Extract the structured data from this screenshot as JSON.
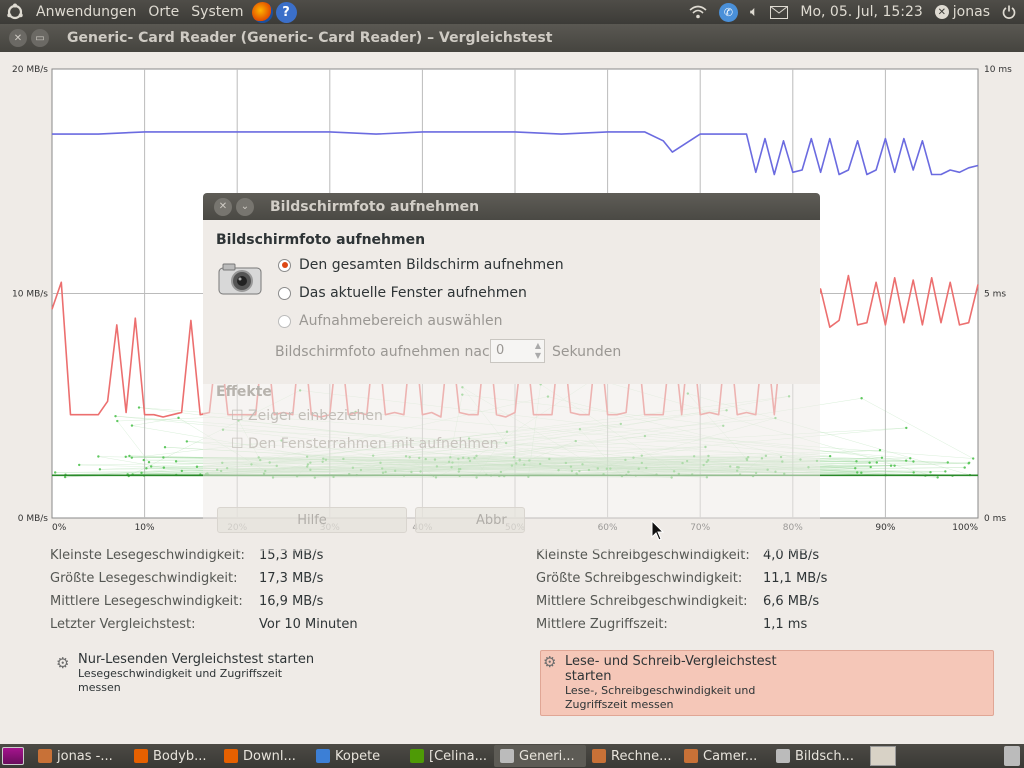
{
  "top_panel": {
    "menus": [
      "Anwendungen",
      "Orte",
      "System"
    ],
    "datetime": "Mo, 05. Jul, 15:23",
    "user": "jonas",
    "icons": [
      "ubuntu-logo-icon",
      "firefox-icon",
      "help-icon",
      "network-icon",
      "chat-icon",
      "volume-icon",
      "mail-icon",
      "power-icon"
    ]
  },
  "window": {
    "title": "Generic- Card Reader (Generic- Card Reader) – Vergleichstest"
  },
  "chart_data": {
    "type": "line",
    "y_left_ticks": [
      "20 MB/s",
      "10 MB/s",
      "0 MB/s"
    ],
    "y_right_ticks": [
      "10 ms",
      "5 ms",
      "0 ms"
    ],
    "x_ticks": [
      "0%",
      "10%",
      "20%",
      "30%",
      "40%",
      "50%",
      "60%",
      "70%",
      "80%",
      "90%",
      "100%"
    ],
    "ylim_left": [
      0,
      20
    ],
    "ylim_right": [
      0,
      10
    ],
    "xlim": [
      0,
      100
    ],
    "grid": true,
    "series": [
      {
        "color": "#6b6be0",
        "x": [
          0,
          5,
          10,
          15,
          20,
          25,
          30,
          35,
          40,
          45,
          50,
          55,
          60,
          64,
          66,
          67,
          70,
          75,
          76,
          77,
          78,
          79,
          80,
          81,
          82,
          83,
          84,
          85,
          86,
          87,
          88,
          89,
          90,
          91,
          92,
          93,
          94,
          95,
          96,
          97,
          98,
          99,
          100
        ],
        "values": [
          17.1,
          17.1,
          17.2,
          17.2,
          17.2,
          17.2,
          17.2,
          17.1,
          17.2,
          17.2,
          17.2,
          17.1,
          17.2,
          17.2,
          16.8,
          16.3,
          17.1,
          17.1,
          15.4,
          16.9,
          15.3,
          16.8,
          15.4,
          15.5,
          16.9,
          15.4,
          16.9,
          15.3,
          15.5,
          16.8,
          15.3,
          15.5,
          16.9,
          15.4,
          16.9,
          15.5,
          16.8,
          15.3,
          15.3,
          15.5,
          15.4,
          15.6,
          15.7
        ]
      },
      {
        "color": "#ec6f6f",
        "x": [
          0,
          1,
          2,
          3,
          4,
          5,
          6,
          7,
          8,
          9,
          10,
          11,
          12,
          13,
          14,
          15,
          16,
          17,
          18,
          19,
          20,
          21,
          22,
          23,
          24,
          25,
          26,
          27,
          28,
          29,
          30,
          31,
          32,
          33,
          34,
          35,
          36,
          37,
          38,
          39,
          40,
          41,
          42,
          43,
          44,
          45,
          46,
          47,
          48,
          49,
          50,
          51,
          52,
          53,
          54,
          55,
          56,
          57,
          58,
          59,
          60,
          61,
          62,
          63,
          64,
          65,
          66,
          67,
          68,
          69,
          70,
          71,
          72,
          73,
          74,
          75,
          76,
          77,
          78,
          79,
          80,
          81,
          82,
          83,
          84,
          85,
          86,
          87,
          88,
          89,
          90,
          91,
          92,
          93,
          94,
          95,
          96,
          97,
          98,
          99,
          100
        ],
        "values": [
          9.3,
          10.5,
          4.6,
          4.6,
          4.6,
          4.6,
          5.2,
          8.6,
          4.7,
          8.9,
          4.6,
          4.6,
          4.5,
          4.6,
          4.7,
          8.8,
          4.6,
          4.7,
          8.4,
          4.6,
          4.6,
          4.6,
          4.6,
          8.8,
          4.6,
          4.7,
          4.6,
          8.8,
          4.6,
          4.5,
          4.6,
          8.5,
          4.6,
          4.7,
          4.6,
          8.8,
          4.6,
          4.7,
          4.6,
          8.8,
          4.6,
          4.7,
          4.5,
          8.5,
          4.7,
          4.6,
          4.6,
          8.8,
          4.6,
          4.5,
          4.7,
          8.5,
          4.6,
          4.6,
          4.6,
          8.8,
          4.7,
          4.6,
          4.6,
          8.6,
          4.6,
          4.6,
          4.7,
          8.8,
          4.6,
          4.6,
          4.6,
          8.5,
          4.6,
          8.8,
          4.6,
          4.7,
          4.6,
          8.8,
          4.6,
          4.7,
          4.6,
          8.6,
          4.6,
          8.9,
          9.5,
          8.7,
          8.8,
          10.2,
          8.5,
          8.8,
          10.8,
          8.6,
          8.7,
          10.5,
          8.6,
          10.7,
          8.7,
          10.6,
          8.6,
          10.7,
          8.7,
          10.5,
          8.6,
          8.7,
          10.4
        ]
      }
    ]
  },
  "stats": {
    "read": [
      {
        "label": "Kleinste Lesegeschwindigkeit:",
        "value": "15,3 MB/s"
      },
      {
        "label": "Größte Lesegeschwindigkeit:",
        "value": "17,3 MB/s"
      },
      {
        "label": "Mittlere Lesegeschwindigkeit:",
        "value": "16,9 MB/s"
      },
      {
        "label": "Letzter Vergleichstest:",
        "value": "Vor 10 Minuten"
      }
    ],
    "write": [
      {
        "label": "Kleinste Schreibgeschwindigkeit:",
        "value": "4,0 MB/s"
      },
      {
        "label": "Größte Schreibgeschwindigkeit:",
        "value": "11,1 MB/s"
      },
      {
        "label": "Mittlere Schreibgeschwindigkeit:",
        "value": "6,6 MB/s"
      },
      {
        "label": "Mittlere Zugriffszeit:",
        "value": "1,1 ms"
      }
    ]
  },
  "actions": {
    "read_title": "Nur-Lesenden Vergleichstest starten",
    "read_sub_1": "Lesegeschwindigkeit und Zugriffszeit",
    "read_sub_2": "messen",
    "write_title_1": "Lese- und Schreib-Vergleichstest",
    "write_title_2": "starten",
    "write_sub_1": "Lese-, Schreibgeschwindigkeit und",
    "write_sub_2": "Zugriffszeit messen"
  },
  "dialog": {
    "title": "Bildschirmfoto aufnehmen",
    "heading": "Bildschirmfoto aufnehmen",
    "options": [
      "Den gesamten Bildschirm aufnehmen",
      "Das aktuelle Fenster aufnehmen",
      "Aufnahmebereich auswählen"
    ],
    "selected": 0,
    "delay_label": "Bildschirmfoto aufnehmen nach",
    "delay_value": "0",
    "delay_unit": "Sekunden",
    "effects_heading": "Effekte",
    "effect_1": "Zeiger einbeziehen",
    "effect_2": "Den Fensterrahmen mit aufnehmen",
    "help_label": "Hilfe",
    "cancel_label": "Abbr"
  },
  "taskbar": [
    {
      "label": "jonas -...",
      "icon": "folder-icon",
      "color": "#c87137"
    },
    {
      "label": "Bodyb...",
      "icon": "firefox-icon",
      "color": "#e66000"
    },
    {
      "label": "Downl...",
      "icon": "firefox-icon",
      "color": "#e66000"
    },
    {
      "label": "Kopete",
      "icon": "kopete-icon",
      "color": "#3c7fd6"
    },
    {
      "label": "[Celina...",
      "icon": "chat-icon",
      "color": "#4e9a06"
    },
    {
      "label": "Generi...",
      "icon": "disk-icon",
      "color": "#bbbbbb"
    },
    {
      "label": "Rechne...",
      "icon": "folder-icon",
      "color": "#c87137"
    },
    {
      "label": "Camer...",
      "icon": "folder-icon",
      "color": "#c87137"
    },
    {
      "label": "Bildsch...",
      "icon": "camera-icon",
      "color": "#bbbbbb"
    }
  ],
  "taskbar_active": 5
}
